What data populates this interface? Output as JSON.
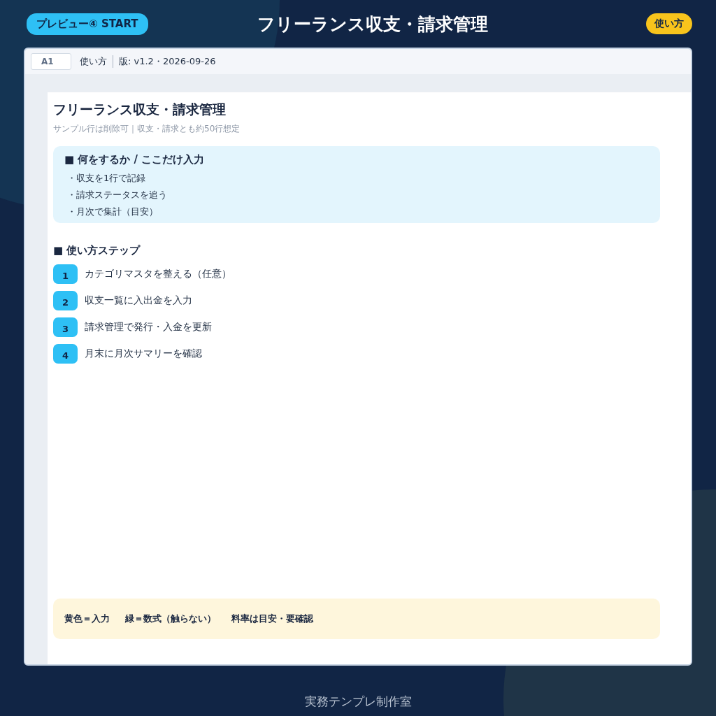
{
  "header": {
    "badge": "プレビュー④ START",
    "title": "フリーランス収支・請求管理",
    "help_button": "使い方"
  },
  "formula_bar": {
    "cell_ref": "A1",
    "sheet_name": "使い方",
    "version": "版: v1.2・2026-09-26"
  },
  "sheet": {
    "title": "フリーランス収支・請求管理",
    "subtitle": "サンプル行は削除可｜収支・請求とも約50行想定",
    "intro": {
      "heading": "■ 何をするか / ここだけ入力",
      "bullets": [
        "・収支を1行で記録",
        "・請求ステータスを追う",
        "・月次で集計（目安）"
      ]
    },
    "steps_heading": "■ 使い方ステップ",
    "steps": [
      {
        "number": "1",
        "text": "カテゴリマスタを整える（任意）"
      },
      {
        "number": "2",
        "text": "収支一覧に入出金を入力"
      },
      {
        "number": "3",
        "text": "請求管理で発行・入金を更新"
      },
      {
        "number": "4",
        "text": "月末に月次サマリーを確認"
      }
    ],
    "legend": [
      "黄色＝入力",
      "緑＝数式（触らない）",
      "料率は目安・要確認"
    ]
  },
  "footer": "実務テンプレ制作室"
}
